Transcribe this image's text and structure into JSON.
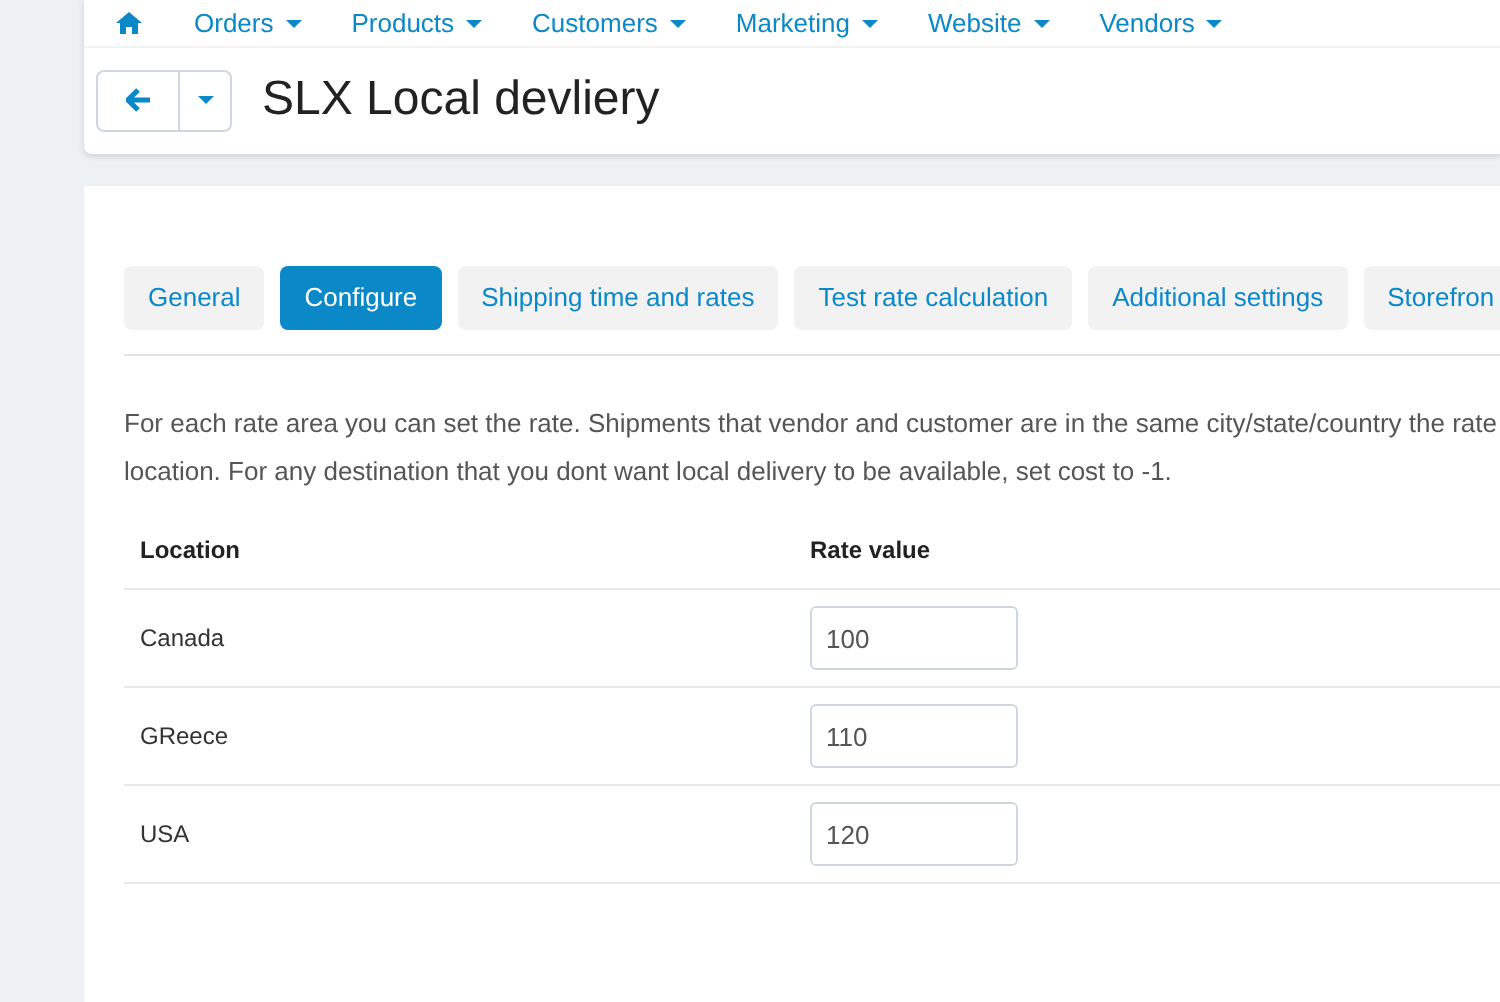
{
  "nav": {
    "items": [
      {
        "label": "Orders"
      },
      {
        "label": "Products"
      },
      {
        "label": "Customers"
      },
      {
        "label": "Marketing"
      },
      {
        "label": "Website"
      },
      {
        "label": "Vendors"
      }
    ]
  },
  "page_title": "SLX Local devliery",
  "tabs": [
    {
      "label": "General",
      "selected": false
    },
    {
      "label": "Configure",
      "selected": true
    },
    {
      "label": "Shipping time and rates",
      "selected": false
    },
    {
      "label": "Test rate calculation",
      "selected": false
    },
    {
      "label": "Additional settings",
      "selected": false
    },
    {
      "label": "Storefron",
      "selected": false
    }
  ],
  "description": "For each rate area you can set the rate. Shipments that vendor and customer are in the same city/state/country the rate\nlocation. For any destination that you dont want local delivery to be available, set cost to -1.",
  "table": {
    "columns": [
      "Location",
      "Rate value"
    ],
    "rows": [
      {
        "location": "Canada",
        "rate": "100"
      },
      {
        "location": "GReece",
        "rate": "110"
      },
      {
        "location": "USA",
        "rate": "120"
      }
    ]
  }
}
